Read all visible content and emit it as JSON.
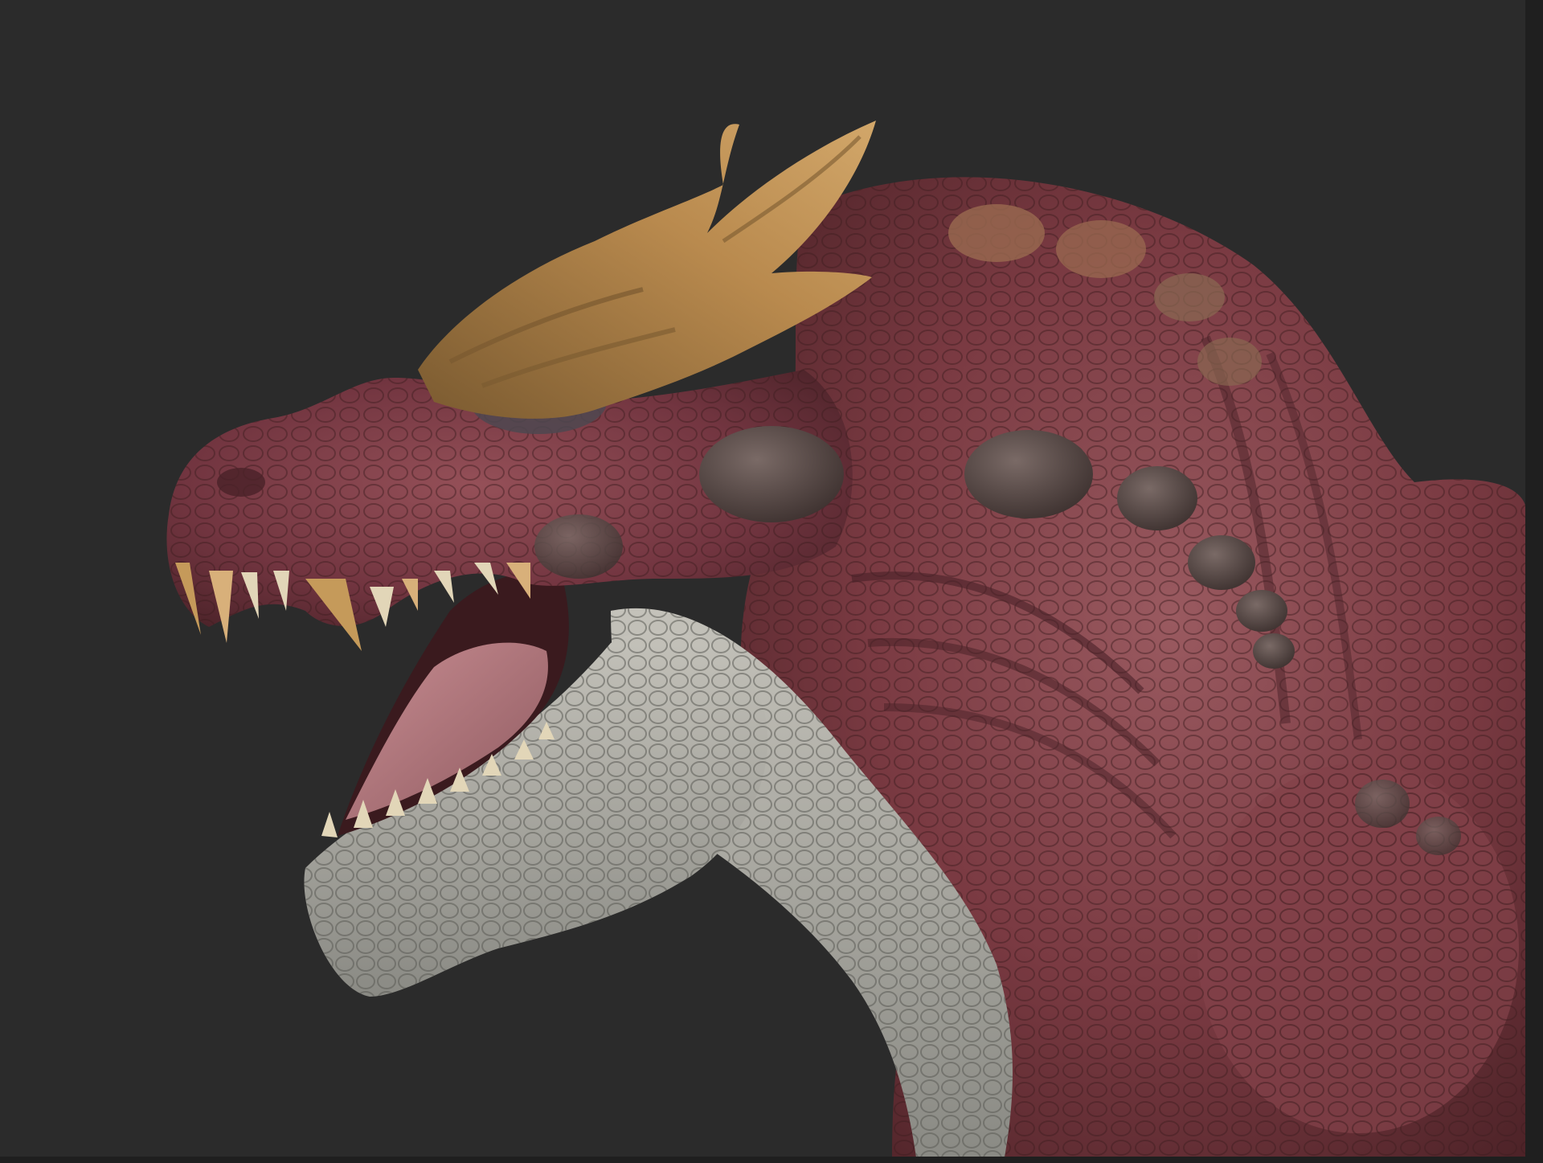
{
  "viewport": {
    "background_color": "#2b2b2b",
    "edge_color": "#1f1f1f"
  },
  "subject": {
    "icon": "dragon-head-sculpt",
    "colors": {
      "skin_red": "#7a3a42",
      "skin_red_light": "#9a5a60",
      "skin_dark": "#4e2328",
      "horn_tan": "#b98a4e",
      "horn_dark": "#7a5a30",
      "belly_gray": "#9a9a94",
      "belly_light": "#c4c2ba",
      "tongue_pink": "#b8797f",
      "mouth_dark": "#3a1a1e",
      "teeth_ivory": "#e2d6b8",
      "teeth_tan": "#c59a5a",
      "knob_gray": "#5a4a48",
      "eye_white": "#e8e8e8"
    }
  }
}
